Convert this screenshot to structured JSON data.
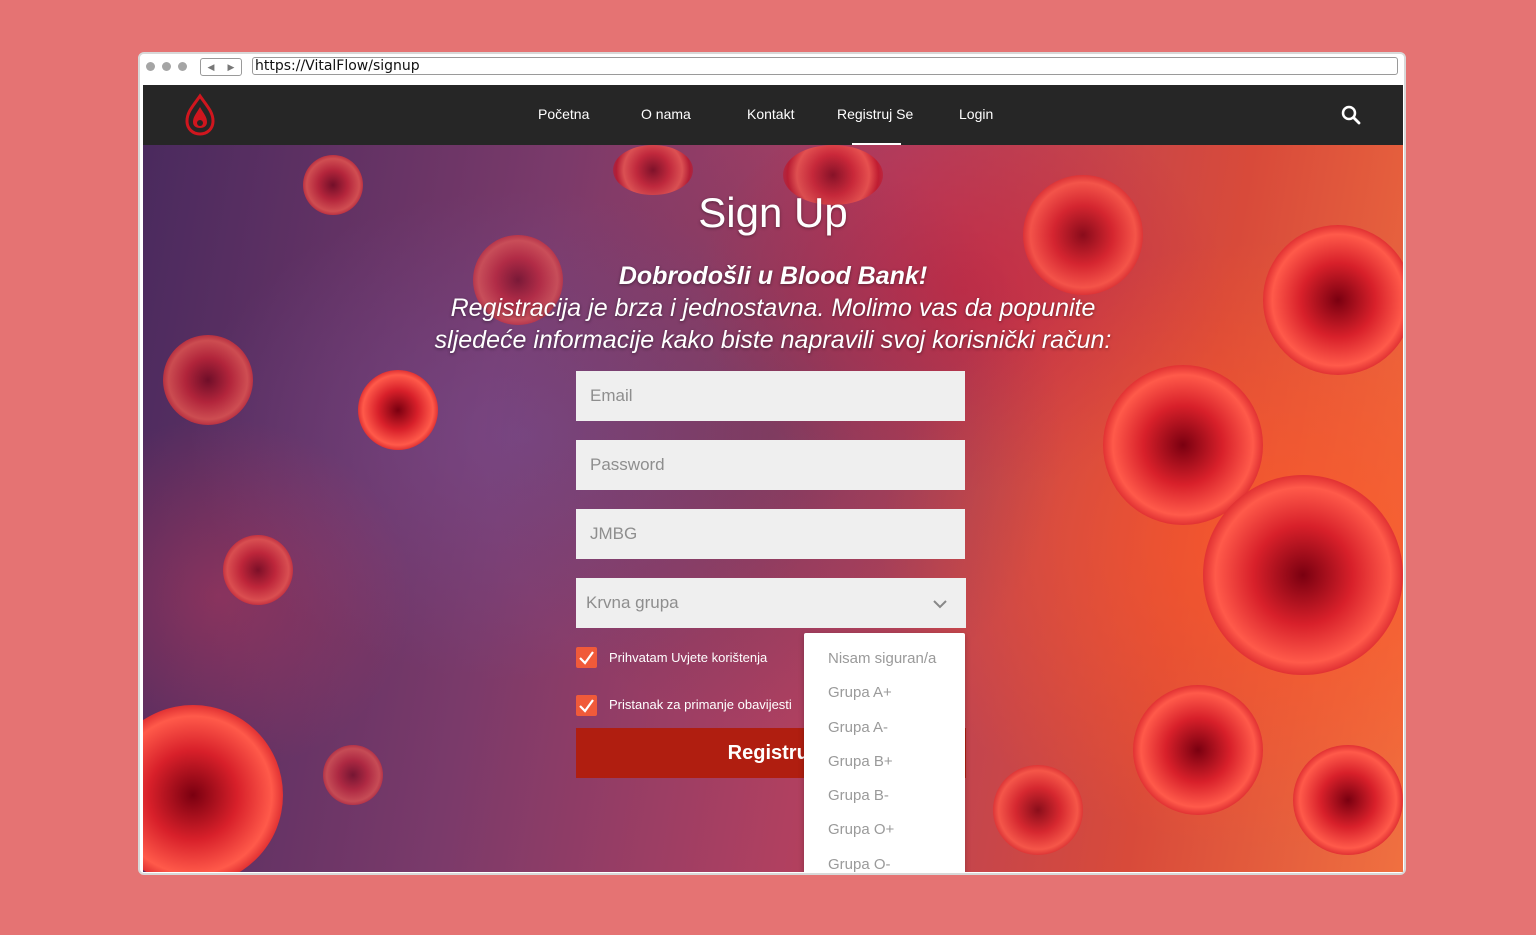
{
  "browser": {
    "url": "https://VitalFlow/signup"
  },
  "nav": {
    "items": [
      "Početna",
      "O nama",
      "Kontakt",
      "Registruj Se",
      "Login"
    ],
    "active": "Registruj Se"
  },
  "signup": {
    "title": "Sign Up",
    "welcome_line1": "Dobrodošli u Blood Bank!",
    "welcome_line2": "Registracija je brza i jednostavna. Molimo vas da popunite",
    "welcome_line3": "sljedeće informacije kako biste napravili svoj korisnički račun:",
    "email_placeholder": "Email",
    "password_placeholder": "Password",
    "jmbg_placeholder": "JMBG",
    "blood_group_placeholder": "Krvna grupa",
    "terms_label": "Prihvatam Uvjete korištenja",
    "notifications_label": "Pristanak za primanje obavijesti",
    "submit_label": "Registruj"
  },
  "dropdown": {
    "options": [
      "Nisam siguran/a",
      "Grupa A+",
      "Grupa A-",
      "Grupa B+",
      "Grupa B-",
      "Grupa O+",
      "Grupa O-"
    ]
  },
  "colors": {
    "accent": "#f05a3a",
    "submit": "#b01e10",
    "navbar": "#262626",
    "background": "#e57373"
  }
}
